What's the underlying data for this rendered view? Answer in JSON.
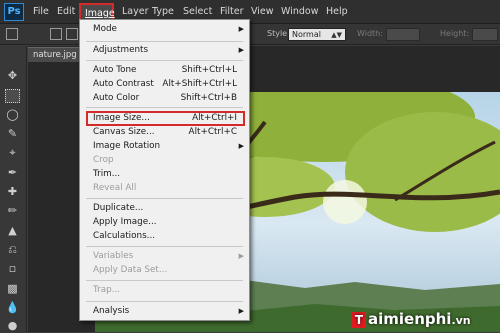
{
  "app": {
    "logo": "Ps"
  },
  "menubar": {
    "items": [
      "File",
      "Edit",
      "Image",
      "Layer",
      "Type",
      "Select",
      "Filter",
      "View",
      "Window",
      "Help"
    ]
  },
  "options": {
    "style_label": "Style:",
    "style_value": "Normal",
    "width_label": "Width:",
    "height_label": "Height:"
  },
  "document": {
    "tab_title": "nature.jpg",
    "close": "×"
  },
  "image_menu": {
    "items": [
      {
        "label": "Mode",
        "shortcut": "",
        "submenu": true,
        "disabled": false
      },
      {
        "label": "Adjustments",
        "shortcut": "",
        "submenu": true,
        "disabled": false
      },
      {
        "label": "Auto Tone",
        "shortcut": "Shift+Ctrl+L",
        "submenu": false,
        "disabled": false
      },
      {
        "label": "Auto Contrast",
        "shortcut": "Alt+Shift+Ctrl+L",
        "submenu": false,
        "disabled": false
      },
      {
        "label": "Auto Color",
        "shortcut": "Shift+Ctrl+B",
        "submenu": false,
        "disabled": false
      },
      {
        "label": "Image Size...",
        "shortcut": "Alt+Ctrl+I",
        "submenu": false,
        "disabled": false,
        "highlighted": true
      },
      {
        "label": "Canvas Size...",
        "shortcut": "Alt+Ctrl+C",
        "submenu": false,
        "disabled": false
      },
      {
        "label": "Image Rotation",
        "shortcut": "",
        "submenu": true,
        "disabled": false
      },
      {
        "label": "Crop",
        "shortcut": "",
        "submenu": false,
        "disabled": true
      },
      {
        "label": "Trim...",
        "shortcut": "",
        "submenu": false,
        "disabled": false
      },
      {
        "label": "Reveal All",
        "shortcut": "",
        "submenu": false,
        "disabled": true
      },
      {
        "label": "Duplicate...",
        "shortcut": "",
        "submenu": false,
        "disabled": false
      },
      {
        "label": "Apply Image...",
        "shortcut": "",
        "submenu": false,
        "disabled": false
      },
      {
        "label": "Calculations...",
        "shortcut": "",
        "submenu": false,
        "disabled": false
      },
      {
        "label": "Variables",
        "shortcut": "",
        "submenu": true,
        "disabled": true
      },
      {
        "label": "Apply Data Set...",
        "shortcut": "",
        "submenu": false,
        "disabled": true
      },
      {
        "label": "Trap...",
        "shortcut": "",
        "submenu": false,
        "disabled": true
      },
      {
        "label": "Analysis",
        "shortcut": "",
        "submenu": true,
        "disabled": false
      }
    ]
  },
  "icons": {
    "submenu_arrow": "chevron-right-icon",
    "tools": [
      "move-tool-icon",
      "marquee-tool-icon",
      "lasso-tool-icon",
      "quick-selection-tool-icon",
      "crop-tool-icon",
      "eyedropper-tool-icon",
      "healing-brush-tool-icon",
      "brush-tool-icon",
      "clone-stamp-tool-icon",
      "history-brush-tool-icon",
      "eraser-tool-icon",
      "gradient-tool-icon",
      "blur-tool-icon",
      "dodge-tool-icon"
    ]
  },
  "watermark": {
    "brand": "aimienphi",
    "suffix": ".vn",
    "mark": "T"
  },
  "colors": {
    "highlight_red": "#d32a2a",
    "menu_bg": "#f0f0f0",
    "ps_blue": "#4fb3ff"
  }
}
